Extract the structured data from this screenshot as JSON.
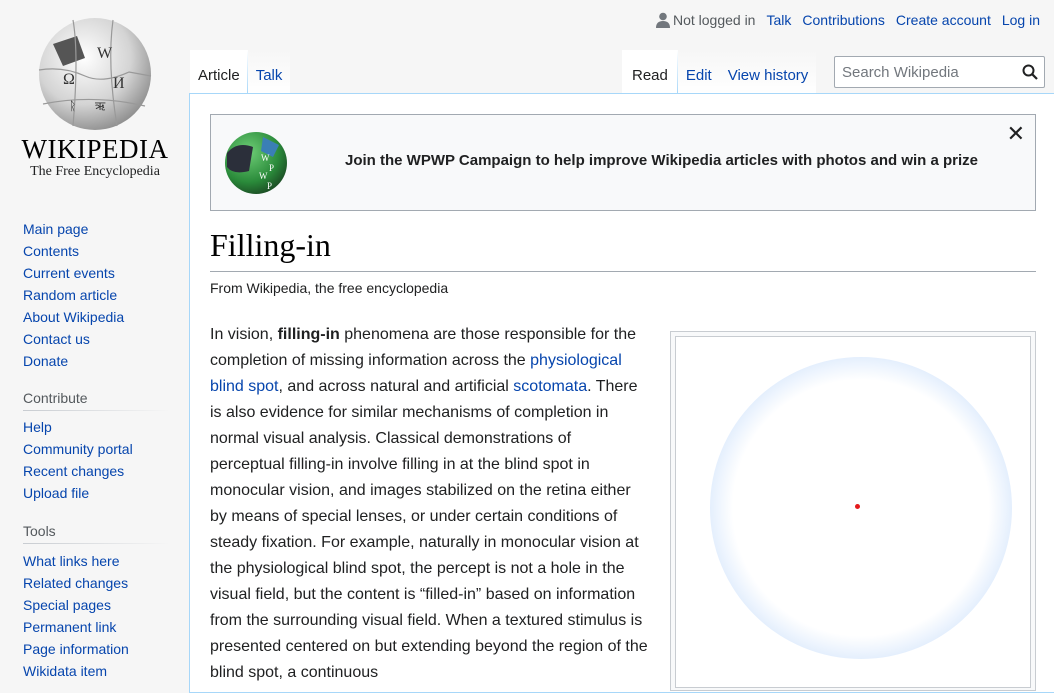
{
  "logo": {
    "wordmark": "WIKIPEDIA",
    "tagline": "The Free Encyclopedia"
  },
  "personal": {
    "status": "Not logged in",
    "links": [
      "Talk",
      "Contributions",
      "Create account",
      "Log in"
    ]
  },
  "tabs": {
    "left": [
      "Article",
      "Talk"
    ],
    "right": [
      "Read",
      "Edit",
      "View history"
    ]
  },
  "search": {
    "placeholder": "Search Wikipedia"
  },
  "sidebar": {
    "navigation": [
      "Main page",
      "Contents",
      "Current events",
      "Random article",
      "About Wikipedia",
      "Contact us",
      "Donate"
    ],
    "contribute": {
      "heading": "Contribute",
      "items": [
        "Help",
        "Community portal",
        "Recent changes",
        "Upload file"
      ]
    },
    "tools": {
      "heading": "Tools",
      "items": [
        "What links here",
        "Related changes",
        "Special pages",
        "Permanent link",
        "Page information",
        "Wikidata item"
      ]
    }
  },
  "banner": {
    "message": "Join the WPWP Campaign to help improve Wikipedia articles with photos and win a prize",
    "close": "✕"
  },
  "article": {
    "title": "Filling-in",
    "tagline": "From Wikipedia, the free encyclopedia",
    "intro": {
      "t1": "In vision, ",
      "bold": "filling-in",
      "t2": " phenomena are those responsible for the completion of missing information across the ",
      "link1": "physiological blind spot",
      "t3": ", and across natural and artificial ",
      "link2": "scotomata",
      "t4": ". There is also evidence for similar mechanisms of completion in normal visual analysis. Classical demonstrations of perceptual filling-in involve filling in at the blind spot in monocular vision, and images stabilized on the retina either by means of special lenses, or under certain conditions of steady fixation. For example, naturally in monocular vision at the physiological blind spot, the percept is not a hole in the visual field, but the content is “filled-in” based on information from the surrounding visual field. When a textured stimulus is presented centered on but extending beyond the region of the blind spot, a continuous"
    }
  },
  "colors": {
    "link": "#0645ad",
    "ring": "#a9ccf8",
    "dot": "#e41a1c"
  }
}
